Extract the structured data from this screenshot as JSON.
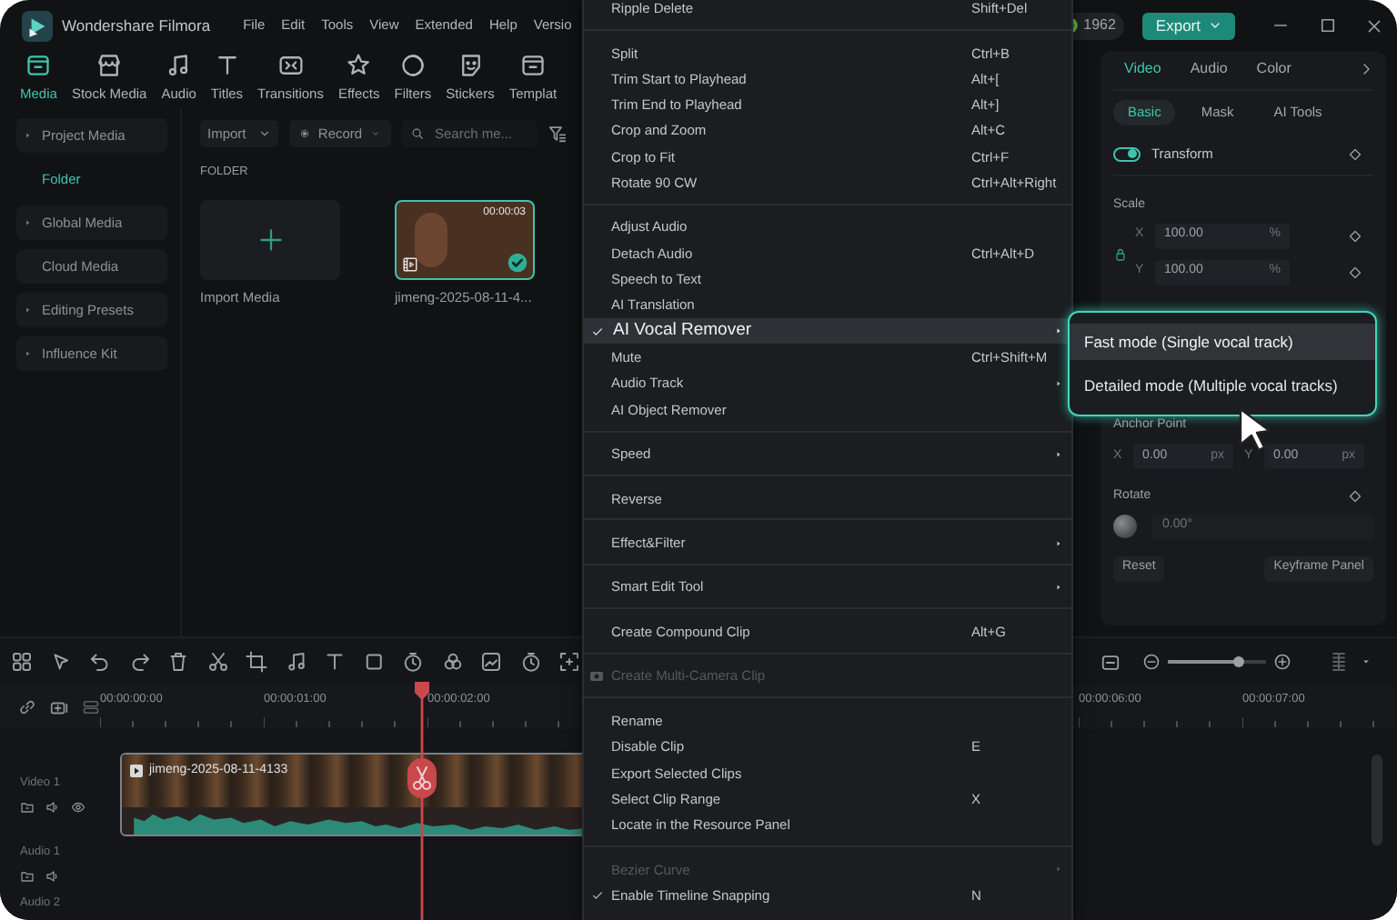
{
  "app": {
    "title": "Wondershare Filmora",
    "menu": [
      "File",
      "Edit",
      "Tools",
      "View",
      "Extended",
      "Help",
      "Versio"
    ],
    "credits": "1962",
    "export_button": "Export"
  },
  "toolbar_tabs": [
    {
      "label": "Media",
      "selected": true
    },
    {
      "label": "Stock Media",
      "selected": false
    },
    {
      "label": "Audio",
      "selected": false
    },
    {
      "label": "Titles",
      "selected": false
    },
    {
      "label": "Transitions",
      "selected": false
    },
    {
      "label": "Effects",
      "selected": false
    },
    {
      "label": "Filters",
      "selected": false
    },
    {
      "label": "Stickers",
      "selected": false
    },
    {
      "label": "Templat",
      "selected": false
    }
  ],
  "sidebar": [
    {
      "label": "Project Media",
      "selected": false,
      "expandable": true
    },
    {
      "label": "Folder",
      "selected": true,
      "expandable": false
    },
    {
      "label": "Global Media",
      "selected": false,
      "expandable": true
    },
    {
      "label": "Cloud Media",
      "selected": false,
      "expandable": false
    },
    {
      "label": "Editing Presets",
      "selected": false,
      "expandable": true
    },
    {
      "label": "Influence Kit",
      "selected": false,
      "expandable": true
    }
  ],
  "media": {
    "import_button": "Import",
    "record_button": "Record",
    "search_placeholder": "Search me...",
    "section": "FOLDER",
    "items": [
      {
        "kind": "import",
        "label": "Import Media",
        "selected": false
      },
      {
        "kind": "clip",
        "label": "jimeng-2025-08-11-4...",
        "duration": "00:00:03",
        "selected": true
      }
    ]
  },
  "properties": {
    "tabs": [
      {
        "label": "Video",
        "selected": true
      },
      {
        "label": "Audio",
        "selected": false
      },
      {
        "label": "Color",
        "selected": false
      }
    ],
    "subtabs": [
      {
        "label": "Basic",
        "selected": true
      },
      {
        "label": "Mask",
        "selected": false
      },
      {
        "label": "AI Tools",
        "selected": false
      }
    ],
    "transform": {
      "label": "Transform",
      "on": true
    },
    "scale": {
      "label": "Scale",
      "fields": [
        {
          "axis": "X",
          "value": "100.00",
          "unit": "%"
        },
        {
          "axis": "Y",
          "value": "100.00",
          "unit": "%"
        }
      ]
    },
    "anchor": {
      "label": "Anchor Point",
      "fields": [
        {
          "axis": "X",
          "value": "0.00",
          "unit": "px"
        },
        {
          "axis": "Y",
          "value": "0.00",
          "unit": "px"
        }
      ]
    },
    "rotate": {
      "label": "Rotate",
      "value": "0.00°"
    },
    "buttons": [
      "Reset",
      "Keyframe Panel"
    ]
  },
  "timeline": {
    "ruler_left": [
      "00:00:00:00",
      "00:00:01:00",
      "00:00:02:00"
    ],
    "ruler_right": [
      "00:00:06:00",
      "00:00:07:00"
    ],
    "zoom": {
      "level": 0.72
    },
    "tracks": [
      {
        "label": "Video 1",
        "kind": "video"
      },
      {
        "label": "Audio 1",
        "kind": "audio"
      },
      {
        "label": "Audio 2",
        "kind": "audio"
      }
    ],
    "clip": {
      "title": "jimeng-2025-08-11-4133"
    }
  },
  "context_menu": [
    {
      "items": [
        {
          "label": "Ripple Delete",
          "shortcut": "Shift+Del",
          "checked": false,
          "disabled": false,
          "submenu": false,
          "selected": false
        }
      ]
    },
    {
      "items": [
        {
          "label": "Split",
          "shortcut": "Ctrl+B",
          "checked": false,
          "disabled": false,
          "submenu": false,
          "selected": false
        },
        {
          "label": "Trim Start to Playhead",
          "shortcut": "Alt+[",
          "checked": false,
          "disabled": false,
          "submenu": false,
          "selected": false
        },
        {
          "label": "Trim End to Playhead",
          "shortcut": "Alt+]",
          "checked": false,
          "disabled": false,
          "submenu": false,
          "selected": false
        },
        {
          "label": "Crop and Zoom",
          "shortcut": "Alt+C",
          "checked": false,
          "disabled": false,
          "submenu": false,
          "selected": false
        },
        {
          "label": "Crop to Fit",
          "shortcut": "Ctrl+F",
          "checked": false,
          "disabled": false,
          "submenu": false,
          "selected": false
        },
        {
          "label": "Rotate 90 CW",
          "shortcut": "Ctrl+Alt+Right",
          "checked": false,
          "disabled": false,
          "submenu": false,
          "selected": false
        }
      ]
    },
    {
      "items": [
        {
          "label": "Adjust Audio",
          "checked": false,
          "disabled": false,
          "submenu": false,
          "selected": false
        },
        {
          "label": "Detach Audio",
          "shortcut": "Ctrl+Alt+D",
          "checked": false,
          "disabled": false,
          "submenu": false,
          "selected": false
        },
        {
          "label": "Speech to Text",
          "checked": false,
          "disabled": false,
          "submenu": false,
          "selected": false
        },
        {
          "label": "AI Translation",
          "checked": false,
          "disabled": false,
          "submenu": false,
          "selected": false
        },
        {
          "label": "AI Vocal Remover",
          "checked": true,
          "disabled": false,
          "submenu": true,
          "selected": true
        },
        {
          "label": "Mute",
          "shortcut": "Ctrl+Shift+M",
          "checked": false,
          "disabled": false,
          "submenu": false,
          "selected": false
        },
        {
          "label": "Audio Track",
          "checked": false,
          "disabled": false,
          "submenu": true,
          "selected": false
        },
        {
          "label": "AI Object Remover",
          "checked": false,
          "disabled": false,
          "submenu": false,
          "selected": false
        }
      ]
    },
    {
      "items": [
        {
          "label": "Speed",
          "checked": false,
          "disabled": false,
          "submenu": true,
          "selected": false
        }
      ]
    },
    {
      "items": [
        {
          "label": "Reverse",
          "checked": false,
          "disabled": false,
          "submenu": false,
          "selected": false
        }
      ]
    },
    {
      "items": [
        {
          "label": "Effect&Filter",
          "checked": false,
          "disabled": false,
          "submenu": true,
          "selected": false
        }
      ]
    },
    {
      "items": [
        {
          "label": "Smart Edit Tool",
          "checked": false,
          "disabled": false,
          "submenu": true,
          "selected": false
        }
      ]
    },
    {
      "items": [
        {
          "label": "Create Compound Clip",
          "shortcut": "Alt+G",
          "checked": false,
          "disabled": false,
          "submenu": false,
          "selected": false
        }
      ]
    },
    {
      "items": [
        {
          "label": "Create Multi-Camera Clip",
          "checked": false,
          "disabled": true,
          "submenu": false,
          "selected": false,
          "kind": "camera"
        }
      ]
    },
    {
      "items": [
        {
          "label": "Rename",
          "checked": false,
          "disabled": false,
          "submenu": false,
          "selected": false
        },
        {
          "label": "Disable Clip",
          "shortcut": "E",
          "checked": false,
          "disabled": false,
          "submenu": false,
          "selected": false
        },
        {
          "label": "Export Selected Clips",
          "checked": false,
          "disabled": false,
          "submenu": false,
          "selected": false
        },
        {
          "label": "Select Clip Range",
          "shortcut": "X",
          "checked": false,
          "disabled": false,
          "submenu": false,
          "selected": false
        },
        {
          "label": "Locate in the Resource Panel",
          "checked": false,
          "disabled": false,
          "submenu": false,
          "selected": false
        }
      ]
    },
    {
      "items": [
        {
          "label": "Bezier Curve",
          "checked": false,
          "disabled": true,
          "submenu": true,
          "selected": false
        },
        {
          "label": "Enable Timeline Snapping",
          "shortcut": "N",
          "checked": true,
          "disabled": false,
          "submenu": false,
          "selected": false
        }
      ]
    }
  ],
  "submenu": [
    {
      "label": "Fast mode (Single vocal track)",
      "selected": true
    },
    {
      "label": "Detailed mode (Multiple vocal tracks)",
      "selected": false
    }
  ]
}
